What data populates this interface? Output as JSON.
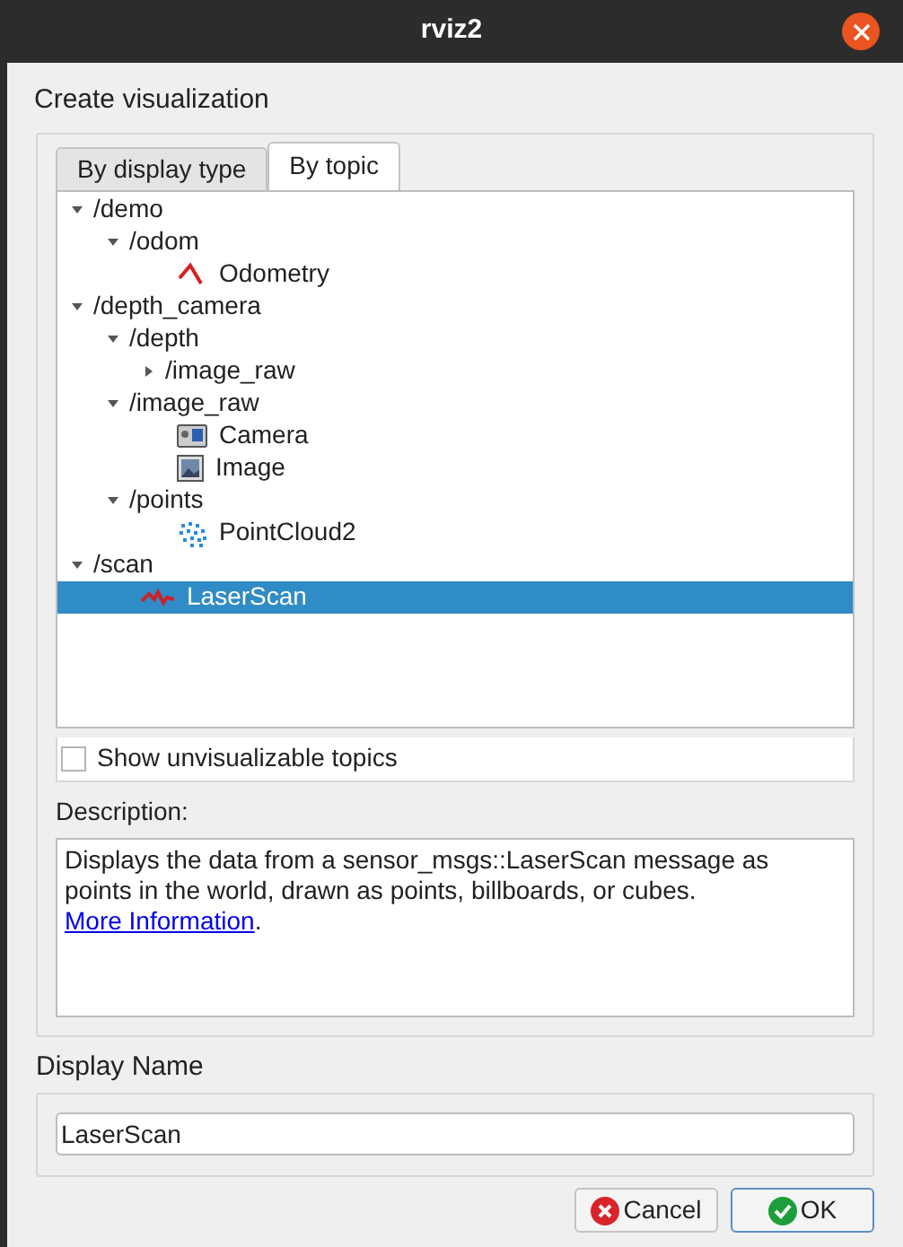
{
  "window": {
    "title": "rviz2"
  },
  "section_title": "Create visualization",
  "tabs": [
    {
      "label": "By display type",
      "selected": false
    },
    {
      "label": "By topic",
      "selected": true
    }
  ],
  "tree": [
    {
      "kind": "topic",
      "label": "/demo",
      "expanded": true,
      "children": [
        {
          "kind": "topic",
          "label": "/odom",
          "expanded": true,
          "children": [
            {
              "kind": "odometry",
              "label": "Odometry",
              "selected": false
            }
          ]
        }
      ]
    },
    {
      "kind": "topic",
      "label": "/depth_camera",
      "expanded": true,
      "children": [
        {
          "kind": "topic",
          "label": "/depth",
          "expanded": true,
          "children": [
            {
              "kind": "topic",
              "label": "/image_raw",
              "expanded": false
            }
          ]
        },
        {
          "kind": "topic",
          "label": "/image_raw",
          "expanded": true,
          "children": [
            {
              "kind": "camera",
              "label": "Camera",
              "selected": false
            },
            {
              "kind": "image",
              "label": "Image",
              "selected": false
            }
          ]
        },
        {
          "kind": "topic",
          "label": "/points",
          "expanded": true,
          "children": [
            {
              "kind": "pointcloud",
              "label": "PointCloud2",
              "selected": false
            }
          ]
        }
      ]
    },
    {
      "kind": "topic",
      "label": "/scan",
      "expanded": true,
      "children": [
        {
          "kind": "laserscan",
          "label": "LaserScan",
          "selected": true
        }
      ]
    }
  ],
  "show_unvisualizable": {
    "label": "Show unvisualizable topics",
    "checked": false
  },
  "description": {
    "label": "Description:",
    "text": "Displays the data from a sensor_msgs::LaserScan message as points in the world, drawn as points, billboards, or cubes.",
    "link": "More Information",
    "after": "."
  },
  "display_name": {
    "label": "Display Name",
    "value": "LaserScan"
  },
  "buttons": [
    {
      "kind": "cancel",
      "label": "Cancel",
      "default": false
    },
    {
      "kind": "ok",
      "label": "OK",
      "default": true
    }
  ]
}
